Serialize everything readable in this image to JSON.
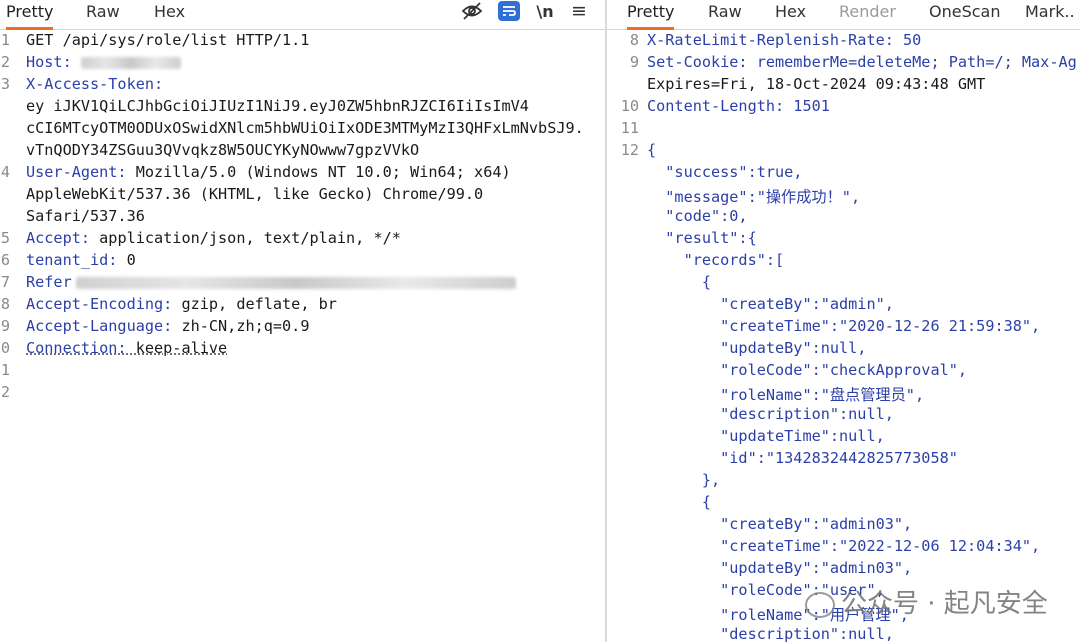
{
  "request_panel": {
    "tabs": [
      "Pretty",
      "Raw",
      "Hex"
    ],
    "active_tab": "Pretty",
    "toolbar_icons": [
      "eye-off-icon",
      "wrap-lines-icon",
      "newline-icon",
      "menu-icon"
    ],
    "newline_label": "\\n",
    "menu_glyph": "≡",
    "lines": [
      {
        "num": "1",
        "key": "",
        "value": "GET /api/sys/role/list HTTP/1.1"
      },
      {
        "num": "2",
        "key": "Host:",
        "value": ""
      },
      {
        "num": "3",
        "key": "X-Access-Token:",
        "value": ""
      },
      {
        "num": "",
        "key": "",
        "value": "ey  iJKV1QiLCJhbGciOiJIUzI1NiJ9.eyJ0ZW5hbnRJZCI6IiIsImV4"
      },
      {
        "num": "",
        "key": "",
        "value": "cCI6MTcyOTM0ODUxOSwidXNlcm5hbWUiOiIxODE3MTMyMzI3QHFxLmNvbSJ9."
      },
      {
        "num": "",
        "key": "",
        "value": "vTnQODY34ZSGuu3QVvqkz8W5OUCYKyNOwww7gpzVVkO"
      },
      {
        "num": "4",
        "key": "User-Agent:",
        "value": " Mozilla/5.0 (Windows NT 10.0; Win64; x64)"
      },
      {
        "num": "",
        "key": "",
        "value": "AppleWebKit/537.36 (KHTML, like Gecko) Chrome/99.0"
      },
      {
        "num": "",
        "key": "",
        "value": "Safari/537.36"
      },
      {
        "num": "5",
        "key": "Accept:",
        "value": " application/json, text/plain, */*"
      },
      {
        "num": "6",
        "key": "tenant_id:",
        "value": " 0"
      },
      {
        "num": "7",
        "key": "Refer",
        "value": ""
      },
      {
        "num": "8",
        "key": "Accept-Encoding:",
        "value": " gzip, deflate, br"
      },
      {
        "num": "9",
        "key": "Accept-Language:",
        "value": " zh-CN,zh;q=0.9"
      },
      {
        "num": "0",
        "key": "Connection:",
        "value": " keep-alive"
      },
      {
        "num": "1",
        "key": "",
        "value": ""
      },
      {
        "num": "2",
        "key": "",
        "value": ""
      }
    ]
  },
  "response_panel": {
    "tabs": [
      "Pretty",
      "Raw",
      "Hex",
      "Render",
      "OneScan",
      "Mark.."
    ],
    "active_tab": "Pretty",
    "disabled_tab": "Render",
    "lines": [
      {
        "num": "8",
        "text": "X-RateLimit-Replenish-Rate: 50"
      },
      {
        "num": "9",
        "text": "Set-Cookie: rememberMe=deleteMe; Path=/; Max-Ag"
      },
      {
        "num": "",
        "text": "Expires=Fri, 18-Oct-2024 09:43:48 GMT"
      },
      {
        "num": "10",
        "text": "Content-Length: 1501"
      },
      {
        "num": "11",
        "text": ""
      },
      {
        "num": "12",
        "text": "{"
      },
      {
        "num": "",
        "text": "  \"success\":true,"
      },
      {
        "num": "",
        "text": "  \"message\":\"操作成功！\","
      },
      {
        "num": "",
        "text": "  \"code\":0,"
      },
      {
        "num": "",
        "text": "  \"result\":{"
      },
      {
        "num": "",
        "text": "    \"records\":["
      },
      {
        "num": "",
        "text": "      {"
      },
      {
        "num": "",
        "text": "        \"createBy\":\"admin\","
      },
      {
        "num": "",
        "text": "        \"createTime\":\"2020-12-26 21:59:38\","
      },
      {
        "num": "",
        "text": "        \"updateBy\":null,"
      },
      {
        "num": "",
        "text": "        \"roleCode\":\"checkApproval\","
      },
      {
        "num": "",
        "text": "        \"roleName\":\"盘点管理员\","
      },
      {
        "num": "",
        "text": "        \"description\":null,"
      },
      {
        "num": "",
        "text": "        \"updateTime\":null,"
      },
      {
        "num": "",
        "text": "        \"id\":\"1342832442825773058\""
      },
      {
        "num": "",
        "text": "      },"
      },
      {
        "num": "",
        "text": "      {"
      },
      {
        "num": "",
        "text": "        \"createBy\":\"admin03\","
      },
      {
        "num": "",
        "text": "        \"createTime\":\"2022-12-06 12:04:34\","
      },
      {
        "num": "",
        "text": "        \"updateBy\":\"admin03\","
      },
      {
        "num": "",
        "text": "        \"roleCode\":\"user\","
      },
      {
        "num": "",
        "text": "        \"roleName\":\"用户管理\","
      },
      {
        "num": "",
        "text": "        \"description\":null,"
      }
    ]
  },
  "watermark": {
    "text": "公众号 · 起凡安全"
  },
  "colors": {
    "accent_tab": "#f26b21",
    "key_blue": "#2b3fa8",
    "wrap_button": "#2f6fd6"
  }
}
